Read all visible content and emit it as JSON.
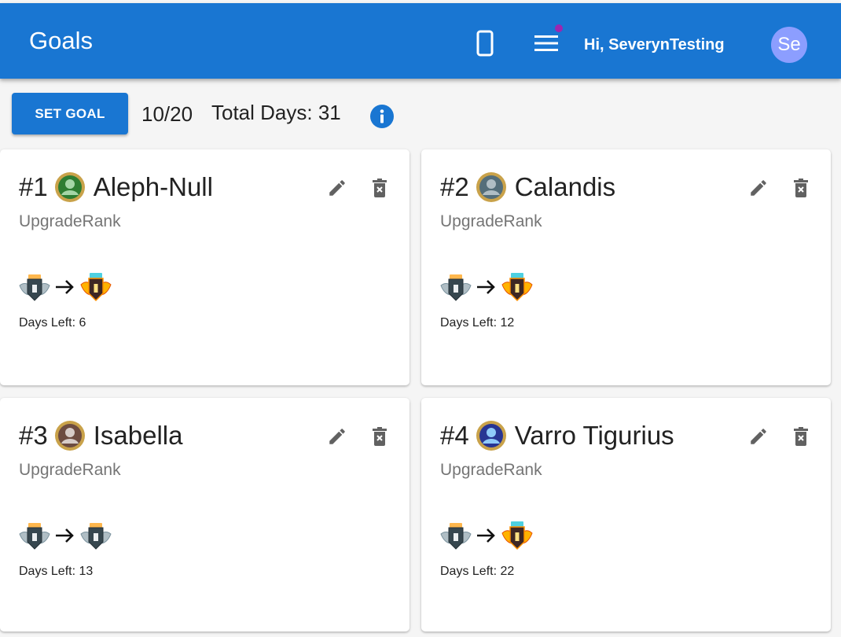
{
  "appbar": {
    "title": "Goals",
    "greeting": "Hi, SeverynTesting",
    "avatar_initials": "Se",
    "phone_icon": "smartphone-icon",
    "menu_icon": "menu-icon",
    "accent_color": "#1976d2",
    "notification_dot_color": "#9c27b0"
  },
  "toolbar": {
    "set_goal_label": "SET GOAL",
    "goals_count": "10/20",
    "total_days": "Total Days: 31",
    "info_icon": "info-icon"
  },
  "goals": [
    {
      "number": "#1",
      "name": "Aleph-Null",
      "type": "UpgradeRank",
      "rank_from": "silver-rank-ii",
      "rank_to": "gold-rank-i",
      "days_left": "Days Left: 6"
    },
    {
      "number": "#2",
      "name": "Calandis",
      "type": "UpgradeRank",
      "rank_from": "silver-rank-i",
      "rank_to": "gold-rank-i",
      "days_left": "Days Left: 12"
    },
    {
      "number": "#3",
      "name": "Isabella",
      "type": "UpgradeRank",
      "rank_from": "silver-rank-i",
      "rank_to": "silver-rank-ii",
      "days_left": "Days Left: 13"
    },
    {
      "number": "#4",
      "name": "Varro Tigurius",
      "type": "UpgradeRank",
      "rank_from": "silver-rank-i",
      "rank_to": "gold-rank-i",
      "days_left": "Days Left: 22"
    }
  ]
}
